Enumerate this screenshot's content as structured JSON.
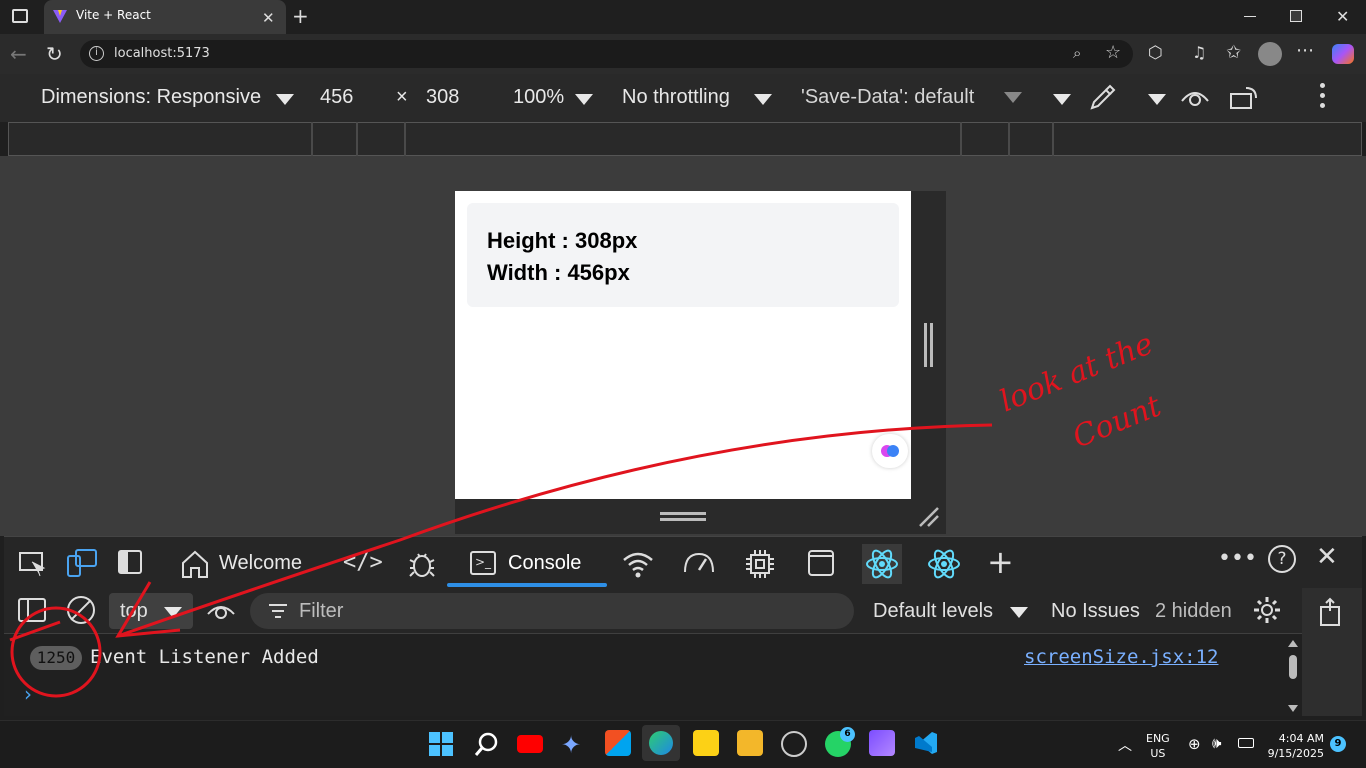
{
  "browser": {
    "tab_title": "Vite + React",
    "url": "localhost:5173"
  },
  "device_toolbar": {
    "dimensions": "Dimensions: Responsive",
    "width": "456",
    "times": "×",
    "height": "308",
    "zoom": "100%",
    "throttling": "No throttling",
    "save_data": "'Save-Data': default"
  },
  "page": {
    "height_line": "Height : 308px",
    "width_line": "Width : 456px"
  },
  "devtools": {
    "tabs": {
      "welcome": "Welcome",
      "console": "Console"
    },
    "console_toolbar": {
      "context": "top",
      "filter_placeholder": "Filter",
      "levels": "Default levels",
      "issues": "No Issues",
      "hidden": "2 hidden"
    },
    "log": {
      "count": "1250",
      "message": "Event Listener Added",
      "source": "screenSize.jsx:12"
    }
  },
  "taskbar": {
    "lang_line1": "ENG",
    "lang_line2": "US",
    "time": "4:04 AM",
    "date": "9/15/2025",
    "notifications": "9",
    "whatsapp_badge": "6"
  },
  "annotation": {
    "line1": "look at the",
    "line2": "Count"
  },
  "colors": {
    "accent": "#2e8fe6",
    "annotation": "#e0141e",
    "link": "#7ab0ff"
  }
}
